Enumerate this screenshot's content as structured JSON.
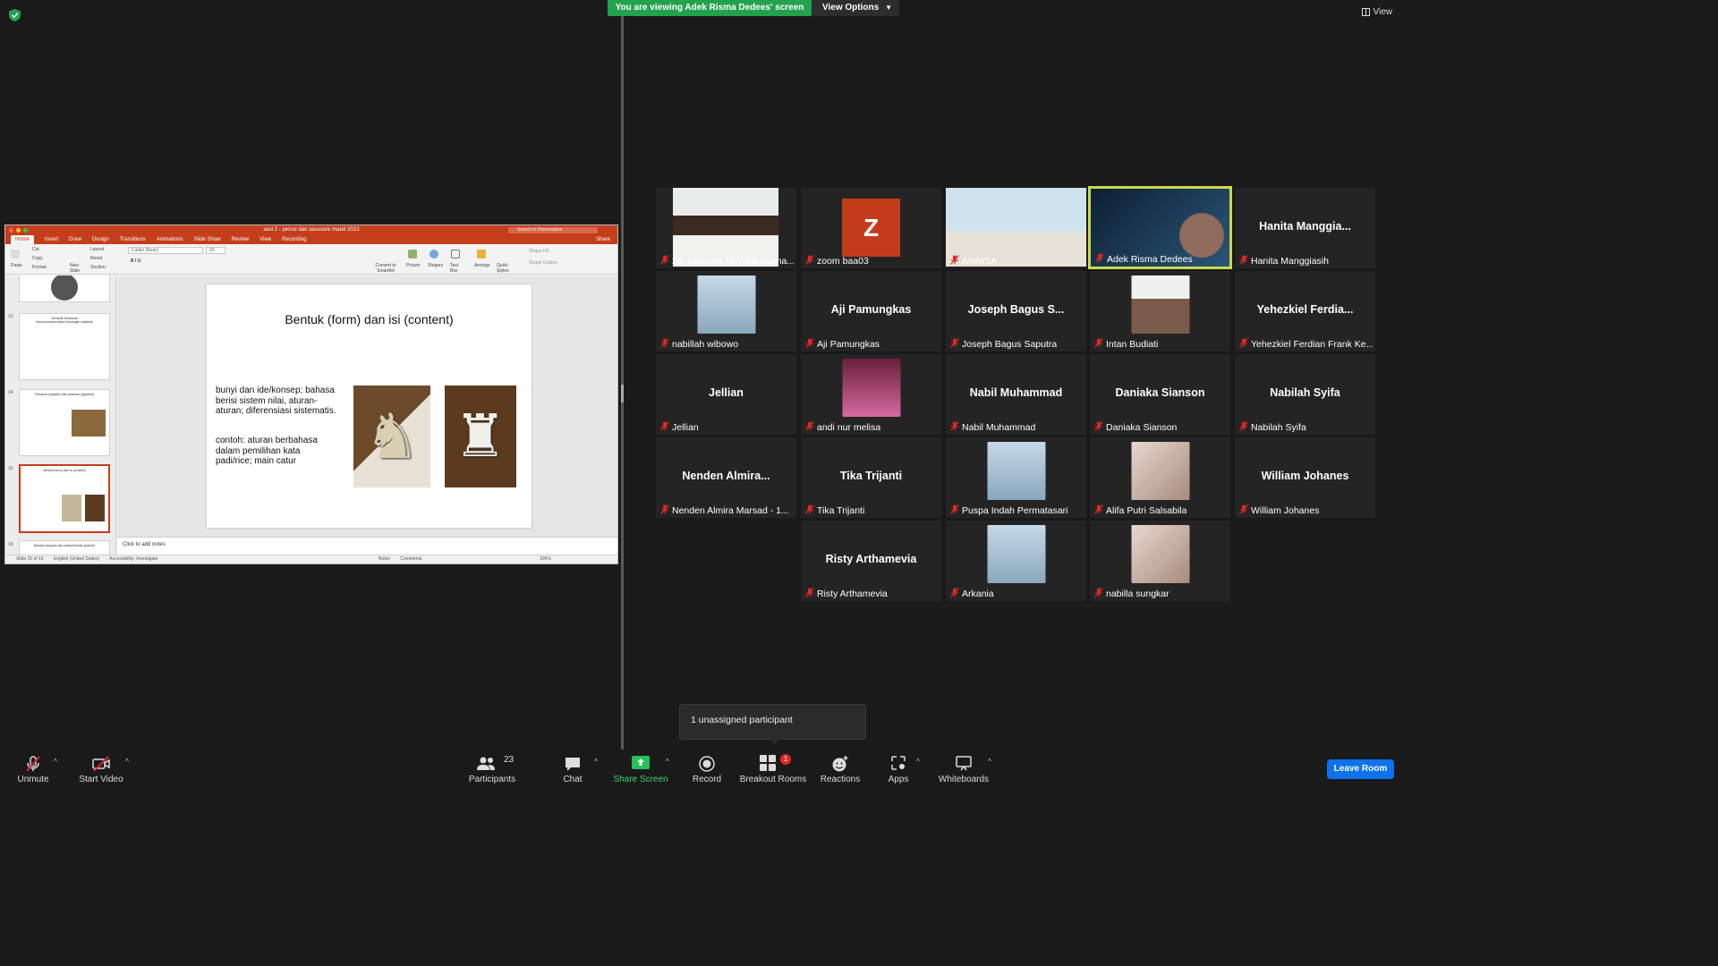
{
  "top": {
    "banner": "You are viewing Adek Risma Dedees' screen",
    "view_options": "View Options",
    "view": "View"
  },
  "ppt": {
    "title": "sesi 2 - peirce dan saussure maret 2023",
    "search_placeholder": "Search in Presentation",
    "tabs": [
      "Home",
      "Insert",
      "Draw",
      "Design",
      "Transitions",
      "Animations",
      "Slide Show",
      "Review",
      "View",
      "Recording"
    ],
    "share": "Share",
    "ribbon": {
      "cut": "Cut",
      "copy": "Copy",
      "format": "Format",
      "paste": "Paste",
      "new_slide": "New Slide",
      "layout": "Layout",
      "reset": "Reset",
      "section": "Section",
      "font": "Calibri (Body)",
      "size": "24",
      "convert": "Convert to SmartArt",
      "picture": "Picture",
      "shapes": "Shapes",
      "text_box": "Text Box",
      "arrange": "Arrange",
      "quick_styles": "Quick Styles",
      "shape_fill": "Shape Fill",
      "shape_outline": "Shape Outline"
    },
    "thumbs": [
      {
        "num": "13",
        "title": "Semiotik Struktural",
        "sub": "Dunda berada dalam hubungan dwipihak"
      },
      {
        "num": "14",
        "title": "Penanda (signifier) dan petanda (signified)"
      },
      {
        "num": "15",
        "title": "Bentuk (form) dan isi (content)"
      },
      {
        "num": "16",
        "title": "Bahasa (langue) dan ujaran/tuturan (parole)"
      }
    ],
    "slide": {
      "title": "Bentuk (form) dan isi (content)",
      "p1": "bunyi dan ide/konsep; bahasa berisi sistem nilai, aturan-aturan; diferensiasi sistematis.",
      "p2": "contoh: aturan berbahasa dalam pemilihan kata padi/rice; main catur"
    },
    "notes": "Click to add notes",
    "status": {
      "slide": "Slide 15 of 19",
      "lang": "English (United States)",
      "access": "Accessibility: Investigate",
      "notes": "Notes",
      "comments": "Comments",
      "zoom": "106%"
    }
  },
  "participants": [
    {
      "name": "20. Karisma Tri Wira Buana...",
      "big": "",
      "kind": "video"
    },
    {
      "name": "zoom baa03",
      "big": "",
      "kind": "avatar",
      "letter": "Z"
    },
    {
      "name": "ANNISA",
      "big": "",
      "kind": "video"
    },
    {
      "name": "Adek Risma Dedees",
      "big": "",
      "kind": "video",
      "active": true
    },
    {
      "name": "Hanita Manggiasih",
      "big": "Hanita Manggia...",
      "kind": "name"
    },
    {
      "name": "nabillah wibowo",
      "big": "",
      "kind": "photo"
    },
    {
      "name": "Aji Pamungkas",
      "big": "Aji Pamungkas",
      "kind": "name"
    },
    {
      "name": "Joseph Bagus Saputra",
      "big": "Joseph Bagus S...",
      "kind": "name"
    },
    {
      "name": "Intan Budiati",
      "big": "",
      "kind": "photo"
    },
    {
      "name": "Yehezkiel Ferdian Frank Ke...",
      "big": "Yehezkiel Ferdia...",
      "kind": "name"
    },
    {
      "name": "Jellian",
      "big": "Jellian",
      "kind": "name"
    },
    {
      "name": "andi nur melisa",
      "big": "",
      "kind": "photo"
    },
    {
      "name": "Nabil Muhammad",
      "big": "Nabil Muhammad",
      "kind": "name"
    },
    {
      "name": "Daniaka Sianson",
      "big": "Daniaka Sianson",
      "kind": "name"
    },
    {
      "name": "Nabilah Syifa",
      "big": "Nabilah Syifa",
      "kind": "name"
    },
    {
      "name": "Nenden Almira Marsad - 1...",
      "big": "Nenden Almira...",
      "kind": "name"
    },
    {
      "name": "Tika Trijanti",
      "big": "Tika Trijanti",
      "kind": "name"
    },
    {
      "name": "Puspa Indah Permatasari",
      "big": "",
      "kind": "photo"
    },
    {
      "name": "Alifa Putri Salsabila",
      "big": "",
      "kind": "photo"
    },
    {
      "name": "William Johanes",
      "big": "William Johanes",
      "kind": "name"
    },
    {
      "name": "Risty Arthamevia",
      "big": "Risty Arthamevia",
      "kind": "name"
    },
    {
      "name": "Arkania",
      "big": "",
      "kind": "photo"
    },
    {
      "name": "nabilla sungkar",
      "big": "",
      "kind": "photo"
    }
  ],
  "popup": "1 unassigned participant",
  "toolbar": {
    "unmute": "Unmute",
    "start_video": "Start Video",
    "participants": "Participants",
    "participants_count": "23",
    "chat": "Chat",
    "share_screen": "Share Screen",
    "record": "Record",
    "breakout": "Breakout Rooms",
    "breakout_badge": "1",
    "reactions": "Reactions",
    "apps": "Apps",
    "whiteboards": "Whiteboards",
    "leave": "Leave Room"
  },
  "colors": {
    "banner_green": "#23a24d",
    "ppt_red": "#c43e1c",
    "active_speaker": "#c9d94e",
    "leave_blue": "#0e72ed"
  }
}
